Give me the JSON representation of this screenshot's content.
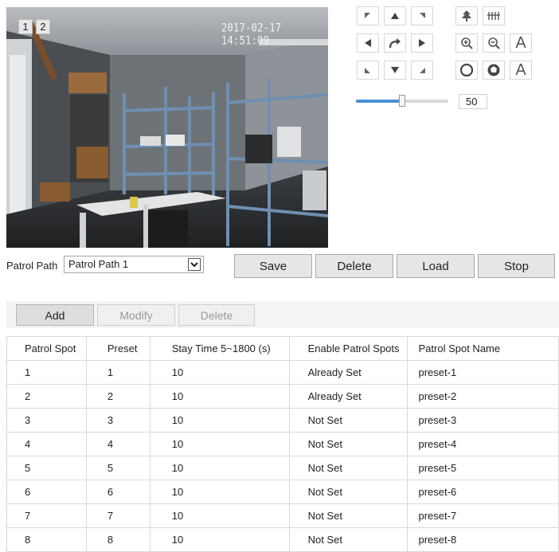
{
  "video": {
    "channel_buttons": [
      "1",
      "2"
    ],
    "timestamp": "2017-02-17 14:51:09"
  },
  "ptz": {
    "icons": [
      "pan-up-left-icon",
      "pan-up-icon",
      "pan-up-right-icon",
      "pan-left-icon",
      "auto-pan-icon",
      "pan-right-icon",
      "pan-down-left-icon",
      "pan-down-icon",
      "pan-down-right-icon",
      "focus-near-icon",
      "focus-far-icon",
      "zoom-in-icon",
      "zoom-out-icon",
      "auto-focus-icon",
      "iris-open-icon",
      "iris-close-icon",
      "auto-iris-icon"
    ],
    "focus_auto_label": "A",
    "iris_auto_label": "A",
    "speed": 50,
    "speed_label": "50",
    "speed_fraction": 0.5
  },
  "patrol": {
    "path_label": "Patrol Path",
    "path_selected": "Patrol Path 1",
    "buttons": {
      "save": "Save",
      "delete": "Delete",
      "load": "Load",
      "stop": "Stop"
    }
  },
  "toolbar": {
    "add": "Add",
    "modify": "Modify",
    "delete": "Delete"
  },
  "table": {
    "headers": [
      "Patrol Spot",
      "Preset",
      "Stay Time 5~1800 (s)",
      "Enable Patrol Spots",
      "Patrol Spot Name"
    ],
    "rows": [
      [
        "1",
        "1",
        "10",
        "Already Set",
        "preset-1"
      ],
      [
        "2",
        "2",
        "10",
        "Already Set",
        "preset-2"
      ],
      [
        "3",
        "3",
        "10",
        "Not Set",
        "preset-3"
      ],
      [
        "4",
        "4",
        "10",
        "Not Set",
        "preset-4"
      ],
      [
        "5",
        "5",
        "10",
        "Not Set",
        "preset-5"
      ],
      [
        "6",
        "6",
        "10",
        "Not Set",
        "preset-6"
      ],
      [
        "7",
        "7",
        "10",
        "Not Set",
        "preset-7"
      ],
      [
        "8",
        "8",
        "10",
        "Not Set",
        "preset-8"
      ]
    ]
  },
  "colors": {
    "slider_fill": "#4a8fd6",
    "button_bg": "#e6e6e6",
    "table_border": "#d9d9d9"
  }
}
